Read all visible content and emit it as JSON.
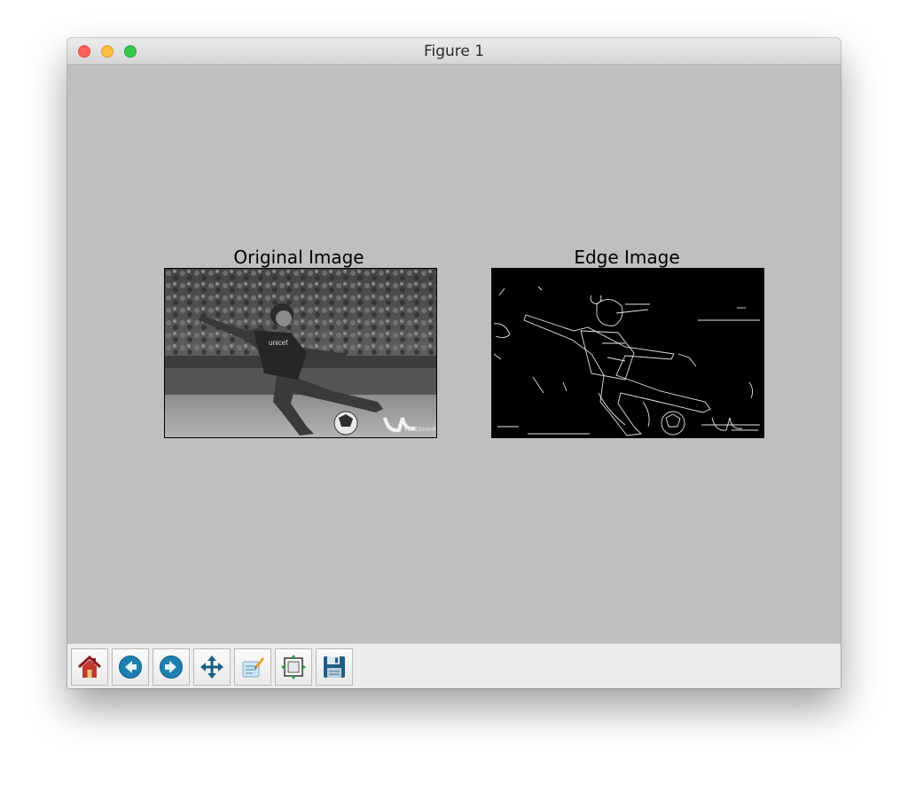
{
  "window": {
    "title": "Figure 1"
  },
  "figure": {
    "panels": [
      {
        "title": "Original Image"
      },
      {
        "title": "Edge Image"
      }
    ]
  },
  "toolbar": {
    "buttons": [
      "home-icon",
      "back-icon",
      "forward-icon",
      "pan-icon",
      "zoom-icon",
      "configure-subplots-icon",
      "save-icon"
    ]
  }
}
